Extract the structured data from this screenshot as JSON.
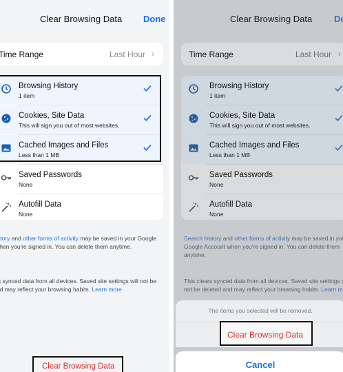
{
  "nav": {
    "title": "Clear Browsing Data",
    "done": "Done"
  },
  "time_range": {
    "label": "Time Range",
    "value": "Last Hour"
  },
  "options": [
    {
      "title": "Browsing History",
      "subtitle": "1 item",
      "icon": "history-icon",
      "selected": true
    },
    {
      "title": "Cookies, Site Data",
      "subtitle": "This will sign you out of most websites.",
      "icon": "cookie-icon",
      "selected": true
    },
    {
      "title": "Cached Images and Files",
      "subtitle": "Less than 1 MB",
      "icon": "image-icon",
      "selected": true
    },
    {
      "title": "Saved Passwords",
      "subtitle": "None",
      "icon": "key-icon",
      "selected": false
    },
    {
      "title": "Autofill Data",
      "subtitle": "None",
      "icon": "magic-wand-icon",
      "selected": false
    }
  ],
  "footer1": {
    "link1": "Search history",
    "and": " and ",
    "link2": "other forms of activity",
    "text": " may be saved in your Google Account when you're signed in. You can delete them anytime."
  },
  "footer2": {
    "text": "This clears synced data from all devices. Saved site settings will not be deleted and may reflect your browsing habits. ",
    "link": "Learn more"
  },
  "clear_button": "Clear Browsing Data",
  "sheet": {
    "message": "The items you selected will be removed.",
    "action": "Clear Browsing Data",
    "cancel": "Cancel"
  },
  "colors": {
    "accent": "#1a73e8",
    "destructive": "#d93025"
  }
}
